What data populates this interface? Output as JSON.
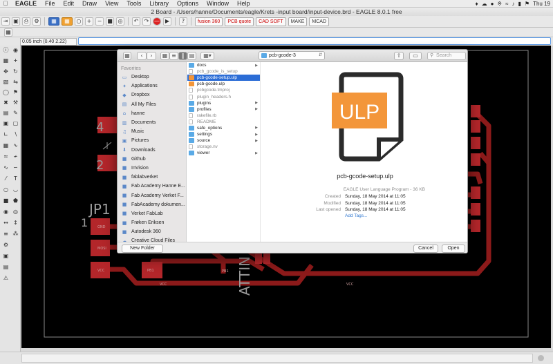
{
  "menubar": {
    "apple_glyph": "",
    "items": [
      "EAGLE",
      "File",
      "Edit",
      "Draw",
      "View",
      "Tools",
      "Library",
      "Options",
      "Window",
      "Help"
    ],
    "clock": "Thu 19"
  },
  "window": {
    "title": "2 Board - /Users/hanne/Documents/eagle/Krets -input board/input-device.brd - EAGLE 8.0.1 free"
  },
  "toolbar": {
    "fusion_label": "fusion 360",
    "pcb_label": "PCB quote",
    "cadsoft_label": "CAD SOFT",
    "make_label": "MAKE",
    "mcad_label": "MCAD"
  },
  "command": {
    "coordinate": "0.05 inch (0.40 2.22)",
    "value": ""
  },
  "canvas": {
    "label_jp": "JP1",
    "pad_numbers": [
      "4",
      "2",
      "1"
    ],
    "part_vertical": "ATTIN",
    "pad_labels": [
      "GND",
      "MOSI",
      "VCC",
      "PB1",
      "PB1",
      "VCC",
      "VCC"
    ]
  },
  "dialog": {
    "path": "pcb-gcode-3",
    "search_placeholder": "Search",
    "favorites_heading": "Favorites",
    "sidebar": [
      {
        "label": "Desktop",
        "icon": "desktop-icon"
      },
      {
        "label": "Applications",
        "icon": "applications-icon"
      },
      {
        "label": "Dropbox",
        "icon": "dropbox-icon"
      },
      {
        "label": "All My Files",
        "icon": "all-files-icon"
      },
      {
        "label": "hanne",
        "icon": "home-icon"
      },
      {
        "label": "Documents",
        "icon": "documents-icon"
      },
      {
        "label": "Music",
        "icon": "music-icon"
      },
      {
        "label": "Pictures",
        "icon": "pictures-icon"
      },
      {
        "label": "Downloads",
        "icon": "downloads-icon"
      },
      {
        "label": "Github",
        "icon": "folder-icon"
      },
      {
        "label": "InVision",
        "icon": "folder-icon"
      },
      {
        "label": "fablabverket",
        "icon": "folder-icon"
      },
      {
        "label": "Fab Academy Hanne E...",
        "icon": "folder-icon"
      },
      {
        "label": "Fab Academy Verket F...",
        "icon": "folder-icon"
      },
      {
        "label": "FabAcademy dokumen...",
        "icon": "folder-icon"
      },
      {
        "label": "Verket FabLab",
        "icon": "folder-icon"
      },
      {
        "label": "Frøken Eriksen",
        "icon": "folder-icon"
      },
      {
        "label": "Autodesk 360",
        "icon": "folder-icon"
      },
      {
        "label": "Creative Cloud Files",
        "icon": "cloud-icon"
      }
    ],
    "files": [
      {
        "name": "docs",
        "kind": "folder",
        "arrow": true,
        "dim": false,
        "selected": false
      },
      {
        "name": "pcb_gcode_is_setup",
        "kind": "file",
        "arrow": false,
        "dim": true,
        "selected": false
      },
      {
        "name": "pcb-gcode-setup.ulp",
        "kind": "ulp",
        "arrow": false,
        "dim": false,
        "selected": true
      },
      {
        "name": "pcb-gcode.ulp",
        "kind": "ulp",
        "arrow": false,
        "dim": false,
        "selected": false
      },
      {
        "name": "pcbgcode.tmproj",
        "kind": "file",
        "arrow": false,
        "dim": true,
        "selected": false
      },
      {
        "name": "plugin_headers.h",
        "kind": "file",
        "arrow": false,
        "dim": true,
        "selected": false
      },
      {
        "name": "plugins",
        "kind": "folder",
        "arrow": true,
        "dim": false,
        "selected": false
      },
      {
        "name": "profiles",
        "kind": "folder",
        "arrow": true,
        "dim": false,
        "selected": false
      },
      {
        "name": "rakefile.rb",
        "kind": "file",
        "arrow": false,
        "dim": true,
        "selected": false
      },
      {
        "name": "README",
        "kind": "file",
        "arrow": false,
        "dim": true,
        "selected": false
      },
      {
        "name": "safe_options",
        "kind": "folder",
        "arrow": true,
        "dim": false,
        "selected": false
      },
      {
        "name": "settings",
        "kind": "folder",
        "arrow": true,
        "dim": false,
        "selected": false
      },
      {
        "name": "source",
        "kind": "folder",
        "arrow": true,
        "dim": false,
        "selected": false
      },
      {
        "name": "storage.nv",
        "kind": "file",
        "arrow": false,
        "dim": true,
        "selected": false
      },
      {
        "name": "viewer",
        "kind": "folder",
        "arrow": true,
        "dim": false,
        "selected": false
      }
    ],
    "preview": {
      "badge": "ULP",
      "name": "pcb-gcode-setup.ulp",
      "kind": "EAGLE User Language Program - 36 KB",
      "created_label": "Created",
      "created": "Sunday, 18 May 2014 at 11:05",
      "modified_label": "Modified",
      "modified": "Sunday, 18 May 2014 at 11:05",
      "opened_label": "Last opened",
      "opened": "Sunday, 18 May 2014 at 11:05",
      "tags_link": "Add Tags..."
    },
    "new_folder_label": "New Folder",
    "cancel_label": "Cancel",
    "open_label": "Open"
  },
  "colors": {
    "accent": "#2c6dd6",
    "ulp_orange": "#f3963a",
    "trace_red": "#8c1a1a",
    "pad_red": "#b3262a"
  }
}
